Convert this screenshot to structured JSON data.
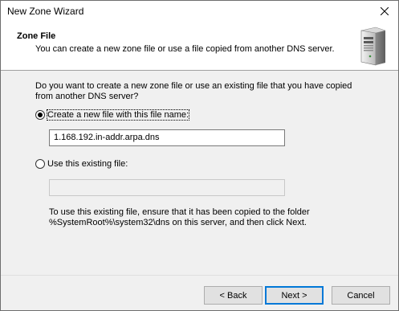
{
  "window": {
    "title": "New Zone Wizard",
    "close_glyph": "✕"
  },
  "header": {
    "title": "Zone File",
    "subtitle": "You can create a new zone file or use a file copied from another DNS server.",
    "icon": "server-icon"
  },
  "content": {
    "question_line1": "Do you want to create a new zone file or use an existing file that you have copied",
    "question_line2": "from another DNS server?",
    "option_new": {
      "label": "Create a new file with this file name:",
      "selected": true,
      "value": "1.168.192.in-addr.arpa.dns"
    },
    "option_existing": {
      "label": "Use this existing file:",
      "selected": false,
      "value": ""
    },
    "note_line1": "To use this existing file, ensure that it has been copied to the folder",
    "note_line2": "%SystemRoot%\\system32\\dns on this server, and then click Next."
  },
  "buttons": {
    "back": "< Back",
    "next": "Next >",
    "cancel": "Cancel"
  }
}
